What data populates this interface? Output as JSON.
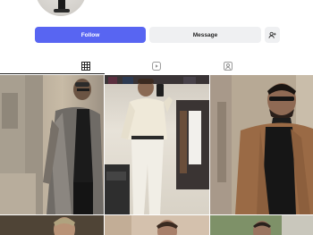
{
  "profile": {
    "avatar_icon": "profile-avatar"
  },
  "actions": {
    "follow_label": "Follow",
    "message_label": "Message",
    "suggest_icon": "add-user-icon",
    "follow_color": "#5865f2",
    "secondary_color": "#eff0f2"
  },
  "tabs": [
    {
      "icon": "grid-icon",
      "active": true
    },
    {
      "icon": "reels-icon",
      "active": false
    },
    {
      "icon": "tagged-icon",
      "active": false
    }
  ],
  "posts": [
    {
      "icon": "photo"
    },
    {
      "icon": "photo"
    },
    {
      "icon": "photo"
    },
    {
      "icon": "photo"
    },
    {
      "icon": "photo"
    },
    {
      "icon": "photo"
    }
  ]
}
